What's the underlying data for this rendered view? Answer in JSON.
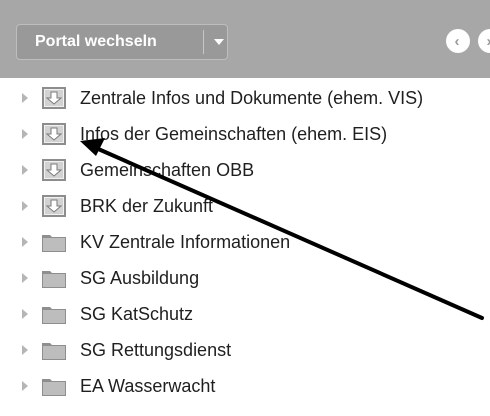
{
  "header": {
    "portal_button_label": "Portal wechseln"
  },
  "tree": [
    {
      "label": "Zentrale Infos und Dokumente (ehem. VIS)",
      "icon": "download-folder-icon"
    },
    {
      "label": "Infos der Gemeinschaften (ehem. EIS)",
      "icon": "download-folder-icon"
    },
    {
      "label": "Gemeinschaften OBB",
      "icon": "download-folder-icon"
    },
    {
      "label": "BRK der Zukunft",
      "icon": "download-folder-icon"
    },
    {
      "label": "KV Zentrale Informationen",
      "icon": "folder-icon"
    },
    {
      "label": "SG Ausbildung",
      "icon": "folder-icon"
    },
    {
      "label": "SG KatSchutz",
      "icon": "folder-icon"
    },
    {
      "label": "SG Rettungsdienst",
      "icon": "folder-icon"
    },
    {
      "label": "EA Wasserwacht",
      "icon": "folder-icon"
    }
  ],
  "colors": {
    "topbar": "#a7a7a7",
    "button": "#999999",
    "text": "#1f1f1f",
    "annotation_arrow": "#000000"
  }
}
